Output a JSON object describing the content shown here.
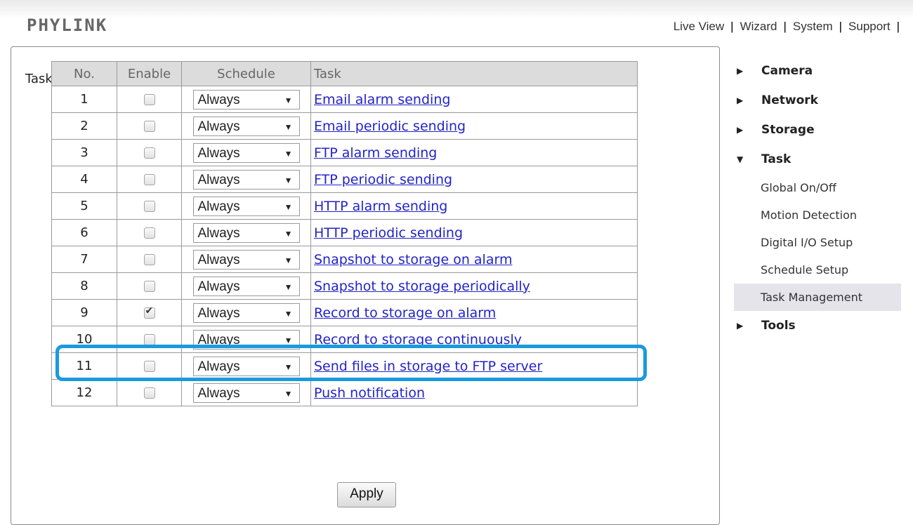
{
  "header": {
    "logo": "PHYLINK",
    "nav": [
      "Live View",
      "Wizard",
      "System",
      "Support"
    ],
    "separator": "|"
  },
  "main": {
    "title": "Task Management",
    "columns": [
      "No.",
      "Enable",
      "Schedule",
      "Task"
    ],
    "rows": [
      {
        "no": "1",
        "enabled": false,
        "schedule": "Always",
        "task": "Email alarm sending"
      },
      {
        "no": "2",
        "enabled": false,
        "schedule": "Always",
        "task": "Email periodic sending"
      },
      {
        "no": "3",
        "enabled": false,
        "schedule": "Always",
        "task": "FTP alarm sending"
      },
      {
        "no": "4",
        "enabled": false,
        "schedule": "Always",
        "task": "FTP periodic sending"
      },
      {
        "no": "5",
        "enabled": false,
        "schedule": "Always",
        "task": "HTTP alarm sending"
      },
      {
        "no": "6",
        "enabled": false,
        "schedule": "Always",
        "task": "HTTP periodic sending"
      },
      {
        "no": "7",
        "enabled": false,
        "schedule": "Always",
        "task": "Snapshot to storage on alarm"
      },
      {
        "no": "8",
        "enabled": false,
        "schedule": "Always",
        "task": "Snapshot to storage periodically"
      },
      {
        "no": "9",
        "enabled": true,
        "schedule": "Always",
        "task": "Record to storage on alarm"
      },
      {
        "no": "10",
        "enabled": false,
        "schedule": "Always",
        "task": "Record to storage continuously"
      },
      {
        "no": "11",
        "enabled": false,
        "schedule": "Always",
        "task": "Send files in storage to FTP server"
      },
      {
        "no": "12",
        "enabled": false,
        "schedule": "Always",
        "task": "Push notification"
      }
    ],
    "apply_label": "Apply",
    "highlight_color": "#1a9ae0"
  },
  "sidebar": {
    "sections": [
      {
        "label": "Camera",
        "expanded": false
      },
      {
        "label": "Network",
        "expanded": false
      },
      {
        "label": "Storage",
        "expanded": false
      },
      {
        "label": "Task",
        "expanded": true,
        "items": [
          "Global On/Off",
          "Motion Detection",
          "Digital I/O Setup",
          "Schedule Setup",
          "Task Management"
        ],
        "active": "Task Management"
      },
      {
        "label": "Tools",
        "expanded": false
      }
    ]
  }
}
